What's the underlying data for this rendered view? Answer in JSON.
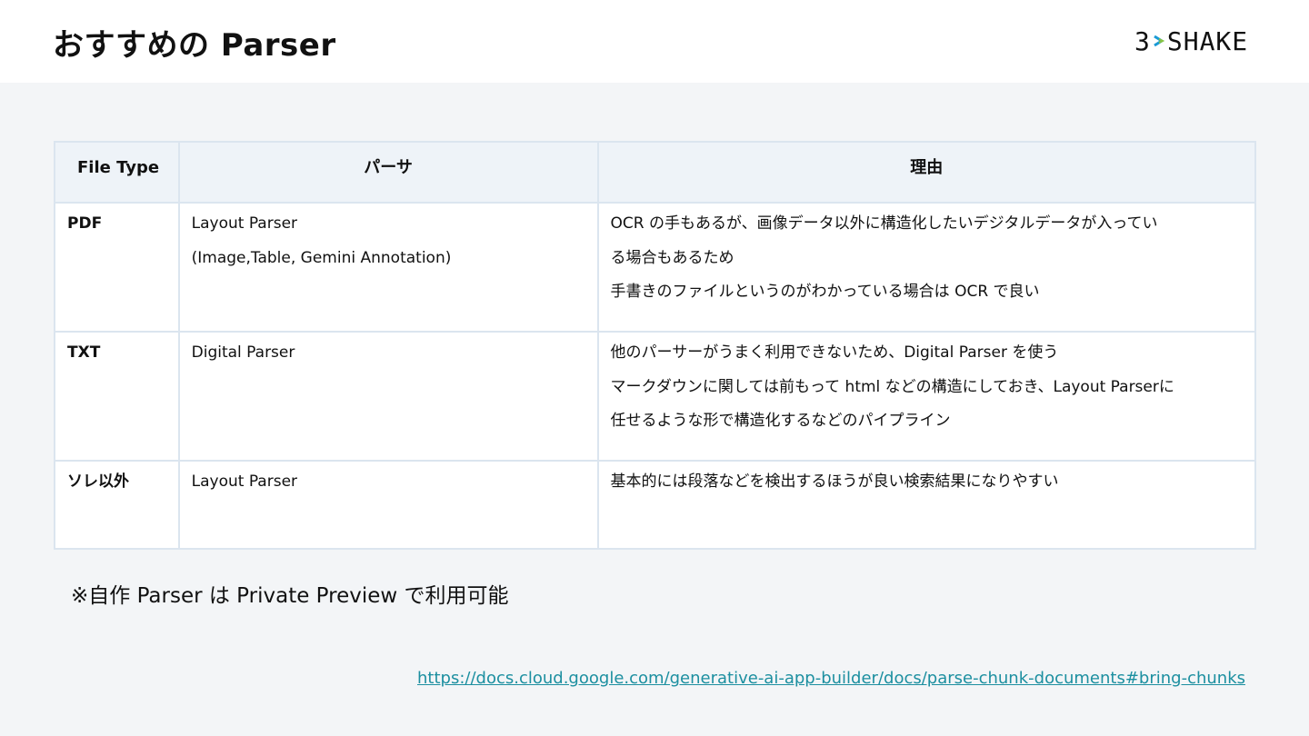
{
  "header": {
    "title": "おすすめの Parser",
    "logo_text_left": "3",
    "logo_text_right": "SHAKE",
    "logo_mark_icon": "chevron-arrow-icon",
    "logo_colors": [
      "#1a9ad6",
      "#8cc63f"
    ]
  },
  "table": {
    "headers": [
      "File Type",
      "パーサ",
      "理由"
    ],
    "rows": [
      {
        "type": "PDF",
        "parser": [
          "Layout Parser",
          "(Image,Table, Gemini Annotation)"
        ],
        "reason": [
          "OCR の手もあるが、画像データ以外に構造化したいデジタルデータが入ってい",
          "る場合もあるため",
          "手書きのファイルというのがわかっている場合は OCR で良い"
        ]
      },
      {
        "type": "TXT",
        "parser": [
          "Digital Parser"
        ],
        "reason": [
          "他のパーサーがうまく利用できないため、Digital Parser を使う",
          "マークダウンに関しては前もって html などの構造にしておき、Layout Parserに",
          "任せるような形で構造化するなどのパイプライン"
        ]
      },
      {
        "type": "ソレ以外",
        "parser": [
          "Layout Parser"
        ],
        "reason": [
          "基本的には段落などを検出するほうが良い検索結果になりやすい"
        ]
      }
    ]
  },
  "note": "※自作 Parser は Private Preview で利用可能",
  "link": "https://docs.cloud.google.com/generative-ai-app-builder/docs/parse-chunk-documents#bring-chunks"
}
